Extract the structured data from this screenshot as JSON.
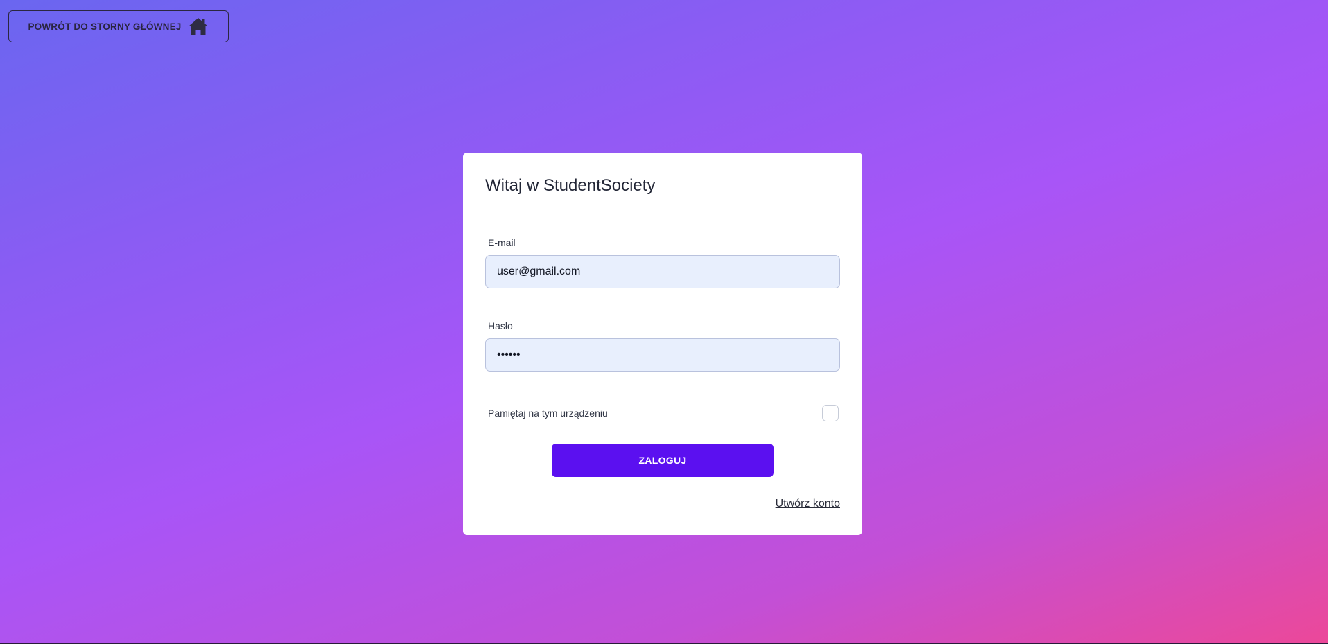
{
  "header": {
    "back_button_label": "POWRÓT DO STORNY GŁÓWNEJ",
    "back_button_icon": "home-icon"
  },
  "login_card": {
    "title": "Witaj w StudentSociety",
    "email": {
      "label": "E-mail",
      "value": "user@gmail.com"
    },
    "password": {
      "label": "Hasło",
      "value": "••••••"
    },
    "remember": {
      "label": "Pamiętaj na tym urządzeniu",
      "checked": false
    },
    "submit_label": "ZALOGUJ",
    "create_account_label": "Utwórz konto"
  },
  "colors": {
    "background_gradient_start": "#6a66f0",
    "background_gradient_mid": "#a855f7",
    "background_gradient_end": "#ec4899",
    "primary_button": "#5b10f0",
    "input_background": "#e8effd"
  }
}
